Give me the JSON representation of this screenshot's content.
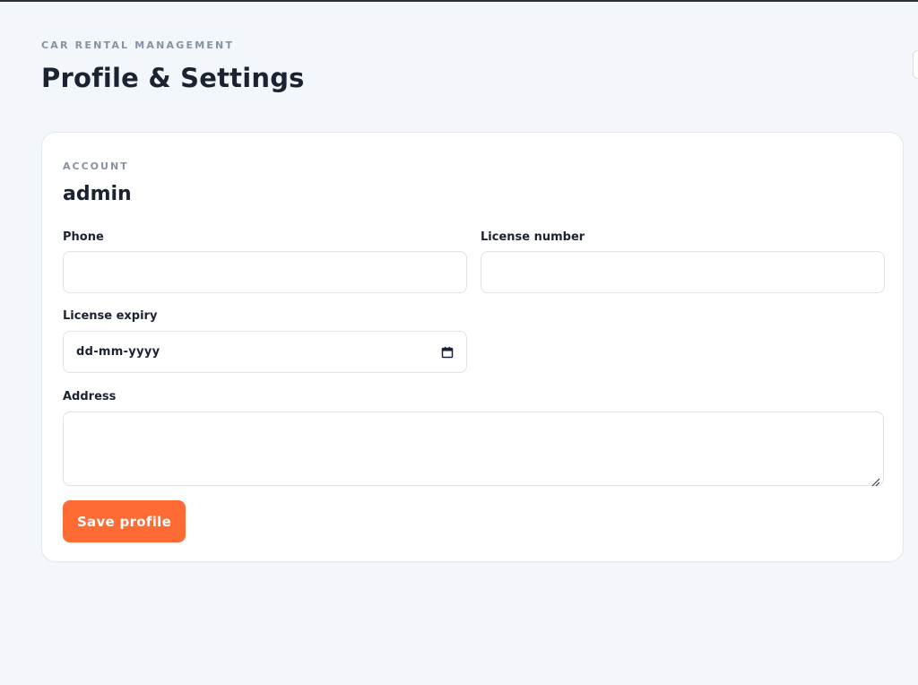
{
  "header": {
    "eyebrow": "CAR RENTAL MANAGEMENT",
    "title": "Profile & Settings"
  },
  "account": {
    "section_label": "ACCOUNT",
    "username": "admin"
  },
  "form": {
    "phone": {
      "label": "Phone",
      "value": ""
    },
    "license_number": {
      "label": "License number",
      "value": ""
    },
    "license_expiry": {
      "label": "License expiry",
      "placeholder": "dd-mm-yyyy"
    },
    "address": {
      "label": "Address",
      "value": ""
    },
    "save_label": "Save profile"
  },
  "colors": {
    "accent": "#ff6b35",
    "background": "#f3f6fa",
    "card": "#ffffff",
    "text": "#1b2332",
    "muted": "#8792a3"
  },
  "icons": {
    "date_picker": "calendar-icon",
    "textarea_resize": "resize-grip-icon"
  }
}
